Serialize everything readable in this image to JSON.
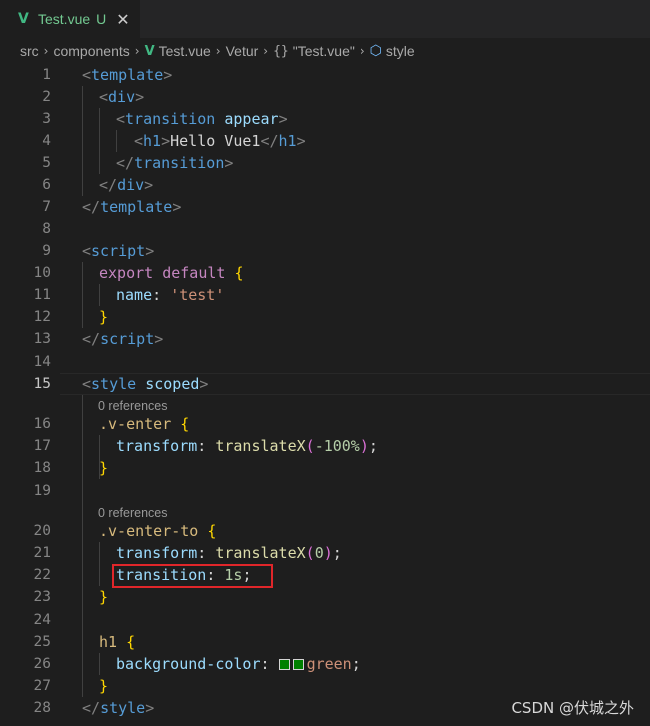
{
  "tab": {
    "icon": "vue-icon",
    "icon_glyph": "V",
    "name": "Test.vue",
    "status": "U",
    "close": "✕"
  },
  "breadcrumb": {
    "items": [
      "src",
      "components",
      "Test.vue",
      "Vetur",
      "\"Test.vue\"",
      "style"
    ],
    "sep": "›",
    "braces": "{}",
    "cube": "⬡"
  },
  "codelens": {
    "ref1": "0 references",
    "ref2": "0 references"
  },
  "line_numbers": [
    "1",
    "2",
    "3",
    "4",
    "5",
    "6",
    "7",
    "8",
    "9",
    "10",
    "11",
    "12",
    "13",
    "14",
    "15",
    "16",
    "17",
    "18",
    "19",
    "20",
    "21",
    "22",
    "23",
    "24",
    "25",
    "26",
    "27",
    "28"
  ],
  "active_line": "15",
  "code": {
    "l1": [
      "<",
      "template",
      ">"
    ],
    "l2": [
      "<",
      "div",
      ">"
    ],
    "l3": [
      "<",
      "transition",
      " ",
      "appear",
      ">"
    ],
    "l4": [
      "<",
      "h1",
      ">",
      "Hello Vue1",
      "</",
      "h1",
      ">"
    ],
    "l5": [
      "</",
      "transition",
      ">"
    ],
    "l6": [
      "</",
      "div",
      ">"
    ],
    "l7": [
      "</",
      "template",
      ">"
    ],
    "l9": [
      "<",
      "script",
      ">"
    ],
    "l10": [
      "export",
      " ",
      "default",
      " ",
      "{"
    ],
    "l11": [
      "name",
      ": ",
      "'test'"
    ],
    "l12": [
      "}"
    ],
    "l13": [
      "</",
      "script",
      ">"
    ],
    "l15": [
      "<",
      "style",
      " ",
      "scoped",
      ">"
    ],
    "l16": [
      ".v-enter",
      " ",
      "{"
    ],
    "l17": [
      "transform",
      ": ",
      "translateX",
      "(",
      "-100%",
      ")",
      ";"
    ],
    "l18": [
      "}"
    ],
    "l20": [
      ".v-enter-to",
      " ",
      "{"
    ],
    "l21": [
      "transform",
      ": ",
      "translateX",
      "(",
      "0",
      ")",
      ";"
    ],
    "l22": [
      "transition",
      ": ",
      "1s",
      ";"
    ],
    "l23": [
      "}"
    ],
    "l25": [
      "h1",
      " ",
      "{"
    ],
    "l26": [
      "background-color",
      ": ",
      "green",
      ";"
    ],
    "l27": [
      "}"
    ],
    "l28": [
      "</",
      "style",
      ">"
    ]
  },
  "watermark": "CSDN @伏城之外",
  "colors": {
    "swatch": "#008000",
    "highlight": "#e0262a",
    "vue": "#41b883"
  }
}
